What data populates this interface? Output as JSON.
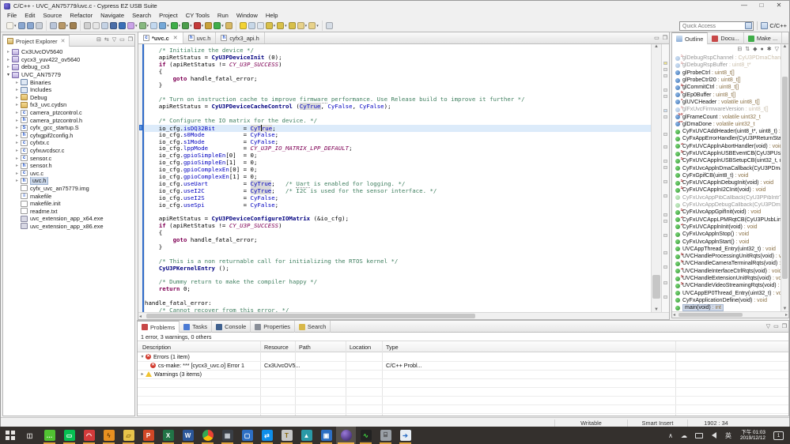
{
  "window": {
    "title": "C/C++ - UVC_AN75779/uvc.c - Cypress EZ USB Suite",
    "controls": {
      "minimize": "—",
      "maximize": "□",
      "close": "✕"
    }
  },
  "menu": [
    "File",
    "Edit",
    "Source",
    "Refactor",
    "Navigate",
    "Search",
    "Project",
    "CY Tools",
    "Run",
    "Window",
    "Help"
  ],
  "toolbar": {
    "quick_access_placeholder": "Quick Access",
    "perspective_label": "C/C++",
    "groups": [
      [
        "new-wizard",
        "save",
        "save-all",
        "print"
      ],
      [
        "skip-breakpoints",
        "build",
        "build-all"
      ],
      [
        "cut",
        "mark-occurrences",
        "step-filters",
        "terminal",
        "sync",
        "new-project",
        "new-class",
        "new-file",
        "search-c",
        "run",
        "debug",
        "profile",
        "coverage",
        "external-tools",
        "open-element"
      ],
      [
        "highlight",
        "block-select",
        "show-whitespace",
        "next-annotation",
        "prev-annotation",
        "last-edit",
        "back",
        "forward"
      ],
      [
        "pin-editor"
      ]
    ]
  },
  "project_explorer": {
    "title": "Project Explorer",
    "items": [
      {
        "l": "Cx3UvcOV5640",
        "d": 0,
        "i": "proj",
        "e": 1
      },
      {
        "l": "cycx3_yuv422_ov5640",
        "d": 0,
        "i": "proj",
        "e": 1
      },
      {
        "l": "debug_cx3",
        "d": 0,
        "i": "proj",
        "e": 1
      },
      {
        "l": "UVC_AN75779",
        "d": 0,
        "i": "proj",
        "e": 2
      },
      {
        "l": "Binaries",
        "d": 1,
        "i": "bin",
        "e": 1
      },
      {
        "l": "Includes",
        "d": 1,
        "i": "inc",
        "e": 1
      },
      {
        "l": "Debug",
        "d": 1,
        "i": "folder",
        "e": 1
      },
      {
        "l": "fx3_uvc.cydsn",
        "d": 1,
        "i": "folder",
        "e": 1
      },
      {
        "l": "camera_ptzcontrol.c",
        "d": 1,
        "i": "c",
        "e": 1
      },
      {
        "l": "camera_ptzcontrol.h",
        "d": 1,
        "i": "h",
        "e": 1
      },
      {
        "l": "cyfx_gcc_startup.S",
        "d": 1,
        "i": "s",
        "e": 1
      },
      {
        "l": "cyfxgpif2config.h",
        "d": 1,
        "i": "h",
        "e": 1
      },
      {
        "l": "cyfxtx.c",
        "d": 1,
        "i": "c",
        "e": 1
      },
      {
        "l": "cyfxuvcdscr.c",
        "d": 1,
        "i": "c",
        "e": 1
      },
      {
        "l": "sensor.c",
        "d": 1,
        "i": "c",
        "e": 1
      },
      {
        "l": "sensor.h",
        "d": 1,
        "i": "h",
        "e": 1
      },
      {
        "l": "uvc.c",
        "d": 1,
        "i": "c",
        "e": 1
      },
      {
        "l": "uvc.h",
        "d": 1,
        "i": "h",
        "e": 1,
        "sel": true
      },
      {
        "l": "cyfx_uvc_an75779.img",
        "d": 1,
        "i": "file",
        "e": 0
      },
      {
        "l": "makefile",
        "d": 1,
        "i": "mk",
        "e": 0
      },
      {
        "l": "makefile.init",
        "d": 1,
        "i": "file",
        "e": 0
      },
      {
        "l": "readme.txt",
        "d": 1,
        "i": "file",
        "e": 0
      },
      {
        "l": "uvc_extension_app_x64.exe",
        "d": 1,
        "i": "exe",
        "e": 0
      },
      {
        "l": "uvc_extension_app_x86.exe",
        "d": 1,
        "i": "exe",
        "e": 0
      }
    ]
  },
  "editor": {
    "tabs": [
      {
        "label": "*uvc.c",
        "active": true
      },
      {
        "label": "uvc.h",
        "active": false
      },
      {
        "label": "cyfx3_api.h",
        "active": false
      }
    ],
    "current_line": 11,
    "lines": [
      [
        [
          "c",
          "    /* Initialize the device */"
        ]
      ],
      [
        [
          "p",
          "    apiRetStatus = "
        ],
        [
          "fn",
          "CyU3PDeviceInit"
        ],
        [
          "p",
          " (0);"
        ]
      ],
      [
        [
          "p",
          "    "
        ],
        [
          "k",
          "if"
        ],
        [
          "p",
          " (apiRetStatus != "
        ],
        [
          "m",
          "CY_U3P_SUCCESS"
        ],
        [
          "p",
          ")"
        ]
      ],
      [
        [
          "p",
          "    {"
        ]
      ],
      [
        [
          "p",
          "        "
        ],
        [
          "k",
          "goto"
        ],
        [
          "p",
          " handle_fatal_error;"
        ]
      ],
      [
        [
          "p",
          "    }"
        ]
      ],
      [],
      [
        [
          "c",
          "    /* Turn on instruction cache to improve "
        ],
        [
          "c sp",
          "firmware"
        ],
        [
          "c",
          " performance. Use Release build to improve it further */"
        ]
      ],
      [
        [
          "p",
          "    apiRetStatus = "
        ],
        [
          "fn",
          "CyU3PDeviceCacheControl"
        ],
        [
          "p",
          " ("
        ],
        [
          "occ",
          "CyTrue"
        ],
        [
          "p",
          ", "
        ],
        [
          "e",
          "CyFalse"
        ],
        [
          "p",
          ", "
        ],
        [
          "e",
          "CyFalse"
        ],
        [
          "p",
          ");"
        ]
      ],
      [],
      [
        [
          "c",
          "    /* Configure the IO matrix for the device. */"
        ]
      ],
      [
        [
          "p",
          "    io_cfg."
        ],
        [
          "e",
          "isDQ32Bit"
        ],
        [
          "p",
          "        = "
        ],
        [
          "occ",
          "CyT"
        ],
        [
          "caret",
          ""
        ],
        [
          "occ",
          "rue"
        ],
        [
          "p",
          ";"
        ]
      ],
      [
        [
          "p",
          "    io_cfg."
        ],
        [
          "e",
          "s0Mode"
        ],
        [
          "p",
          "           = "
        ],
        [
          "e",
          "CyFalse"
        ],
        [
          "p",
          ";"
        ]
      ],
      [
        [
          "p",
          "    io_cfg."
        ],
        [
          "e",
          "s1Mode"
        ],
        [
          "p",
          "           = "
        ],
        [
          "e",
          "CyFalse"
        ],
        [
          "p",
          ";"
        ]
      ],
      [
        [
          "p",
          "    io_cfg."
        ],
        [
          "e",
          "lppMode"
        ],
        [
          "p",
          "          = "
        ],
        [
          "m",
          "CY_U3P_IO_MATRIX_LPP_DEFAULT"
        ],
        [
          "p",
          ";"
        ]
      ],
      [
        [
          "p",
          "    io_cfg."
        ],
        [
          "e",
          "gpioSimpleEn"
        ],
        [
          "p",
          "[0]  = 0;"
        ]
      ],
      [
        [
          "p",
          "    io_cfg."
        ],
        [
          "e",
          "gpioSimpleEn"
        ],
        [
          "p",
          "[1]  = 0;"
        ]
      ],
      [
        [
          "p",
          "    io_cfg."
        ],
        [
          "e",
          "gpioComplexEn"
        ],
        [
          "p",
          "[0] = 0;"
        ]
      ],
      [
        [
          "p",
          "    io_cfg."
        ],
        [
          "e",
          "gpioComplexEn"
        ],
        [
          "p",
          "[1] = 0;"
        ]
      ],
      [
        [
          "p",
          "    io_cfg."
        ],
        [
          "e",
          "useUart"
        ],
        [
          "p",
          "          = "
        ],
        [
          "occ",
          "CyTrue"
        ],
        [
          "p",
          ";   "
        ],
        [
          "c",
          "/* "
        ],
        [
          "c sp",
          "Uart"
        ],
        [
          "c",
          " is enabled for logging. */"
        ]
      ],
      [
        [
          "p",
          "    io_cfg."
        ],
        [
          "e",
          "useI2C"
        ],
        [
          "p",
          "           = "
        ],
        [
          "occ",
          "CyTrue"
        ],
        [
          "p",
          ";   "
        ],
        [
          "c",
          "/* I2C is used for the sensor interface. */"
        ]
      ],
      [
        [
          "p",
          "    io_cfg."
        ],
        [
          "e",
          "useI2S"
        ],
        [
          "p",
          "           = "
        ],
        [
          "e",
          "CyFalse"
        ],
        [
          "p",
          ";"
        ]
      ],
      [
        [
          "p",
          "    io_cfg."
        ],
        [
          "e",
          "useSpi"
        ],
        [
          "p",
          "           = "
        ],
        [
          "e",
          "CyFalse"
        ],
        [
          "p",
          ";"
        ]
      ],
      [],
      [
        [
          "p",
          "    apiRetStatus = "
        ],
        [
          "fn",
          "CyU3PDeviceConfigureIOMatrix"
        ],
        [
          "p",
          " (&io_cfg);"
        ]
      ],
      [
        [
          "p",
          "    "
        ],
        [
          "k",
          "if"
        ],
        [
          "p",
          " (apiRetStatus != "
        ],
        [
          "m",
          "CY_U3P_SUCCESS"
        ],
        [
          "p",
          ")"
        ]
      ],
      [
        [
          "p",
          "    {"
        ]
      ],
      [
        [
          "p",
          "        "
        ],
        [
          "k",
          "goto"
        ],
        [
          "p",
          " handle_fatal_error;"
        ]
      ],
      [
        [
          "p",
          "    }"
        ]
      ],
      [],
      [
        [
          "c",
          "    /* This is a non returnable call for initializing the RTOS kernel */"
        ]
      ],
      [
        [
          "p",
          "    "
        ],
        [
          "fn",
          "CyU3PKernelEntry"
        ],
        [
          "p",
          " ();"
        ]
      ],
      [],
      [
        [
          "c",
          "    /* Dummy return to make the compiler happy */"
        ]
      ],
      [
        [
          "p",
          "    "
        ],
        [
          "k",
          "return"
        ],
        [
          "p",
          " 0;"
        ]
      ],
      [],
      [
        [
          "p",
          "handle_fatal_error:"
        ]
      ],
      [
        [
          "c",
          "    /* Cannot recover from this error. */"
        ]
      ]
    ]
  },
  "outline": {
    "tabs": [
      "Outline",
      "Docu...",
      "Make ..."
    ],
    "items": [
      {
        "t": "glDebugRspChannel : CyU3PDmaChannel",
        "k": "v",
        "dim": true,
        "b": "S"
      },
      {
        "t": "glDebugRspBuffer : uint8_t*",
        "k": "v",
        "dim": true,
        "b": "S"
      },
      {
        "t": "glProbeCtrl : uint8_t[]",
        "k": "v"
      },
      {
        "t": "glProbeCtrl20 : uint8_t[]",
        "k": "v"
      },
      {
        "t": "glCommitCtrl : uint8_t[]",
        "k": "v",
        "b": "S"
      },
      {
        "t": "glEp0Buffer : uint8_t[]",
        "k": "v",
        "b": "S"
      },
      {
        "t": "glUVCHeader : volatile uint8_t[]",
        "k": "v",
        "b": "V"
      },
      {
        "t": "glFxUvcFirmwareVersion : uint8_t[]",
        "k": "v",
        "dim": true,
        "b": "S"
      },
      {
        "t": "glFrameCount : volatile uint32_t",
        "k": "v",
        "b": "SV"
      },
      {
        "t": "glDmaDone : volatile uint32_t",
        "k": "v",
        "b": "SV"
      },
      {
        "t": "CyFxUVCAddHeader(uint8_t*, uint8_t) : void",
        "k": "m"
      },
      {
        "t": "CyFxAppErrorHandler(CyU3PReturnStatus_t) : void",
        "k": "m"
      },
      {
        "t": "CyFxUVCApplnAbortHandler(void) : void",
        "k": "m",
        "b": "S"
      },
      {
        "t": "CyFxUVCApplnUSBEventCB(CyU3PUsbEventType_t, uint16_t) : void",
        "k": "m",
        "b": "S"
      },
      {
        "t": "CyFxUVCApplnUSBSetupCB(uint32_t, uint32_t) : CyBool_t",
        "k": "m",
        "b": "S"
      },
      {
        "t": "CyFxUvcApplnDmaCallback(CyU3PDmaMultiChannel*) : void",
        "k": "m"
      },
      {
        "t": "CyFxGpifCB(uint8_t) : void",
        "k": "m"
      },
      {
        "t": "CyFxUVCApplnDebugInit(void) : void",
        "k": "m",
        "b": "S"
      },
      {
        "t": "CyFxUVCApplnI2CInit(void) : void",
        "k": "m",
        "b": "S"
      },
      {
        "t": "CyFxUvcAppPibCallback(CyU3PPibIntrType, uint16_t) : void",
        "k": "m",
        "dim": true
      },
      {
        "t": "CyFxUvcAppDebugCallback(CyU3PDmaChannel*) : void",
        "k": "m",
        "dim": true
      },
      {
        "t": "CyFxUvcAppGpifInit(void) : void",
        "k": "m",
        "b": "S"
      },
      {
        "t": "CyFxUVCAppLPMRqtCB(CyU3PUsbLinkPowerMode) : CyBool_t",
        "k": "m",
        "b": "S"
      },
      {
        "t": "CyFxUVCApplnInit(void) : void",
        "k": "m",
        "b": "S"
      },
      {
        "t": "CyFxUvcApplnStop() : void",
        "k": "m"
      },
      {
        "t": "CyFxUvcApplnStart() : void",
        "k": "m"
      },
      {
        "t": "UVCAppThread_Entry(uint32_t) : void",
        "k": "m"
      },
      {
        "t": "UVCHandleProcessingUnitRqts(void) : void",
        "k": "m",
        "b": "S"
      },
      {
        "t": "UVCHandleCameraTerminalRqts(void) : void",
        "k": "m",
        "b": "S"
      },
      {
        "t": "UVCHandleInterfaceCtrlRqts(void) : void",
        "k": "m",
        "b": "S"
      },
      {
        "t": "UVCHandleExtensionUnitRqts(void) : void",
        "k": "m",
        "b": "S"
      },
      {
        "t": "UVCHandleVideoStreamingRqts(void) : void",
        "k": "m",
        "b": "S"
      },
      {
        "t": "UVCAppEP0Thread_Entry(uint32_t) : void",
        "k": "m"
      },
      {
        "t": "CyFxApplicationDefine(void) : void",
        "k": "m"
      },
      {
        "t": "main(void) : int",
        "k": "m",
        "sel": true
      }
    ]
  },
  "problems": {
    "tabs": [
      "Problems",
      "Tasks",
      "Console",
      "Properties",
      "Search"
    ],
    "active_tab": "Problems",
    "summary": "1 error, 3 warnings, 0 others",
    "columns": [
      "Description",
      "Resource",
      "Path",
      "Location",
      "Type"
    ],
    "rows": [
      {
        "kind": "error-group",
        "expanded": true,
        "text": "Errors (1 item)"
      },
      {
        "kind": "error",
        "text": "cs-make: *** [cycx3_uvc.o] Error 1",
        "resource": "Cx3UvcOV5...",
        "path": "",
        "location": "",
        "type": "C/C++ Probl..."
      },
      {
        "kind": "warning-group",
        "expanded": false,
        "text": "Warnings (3 items)"
      }
    ]
  },
  "status_bar": {
    "writable": "Writable",
    "insert_mode": "Smart Insert",
    "caret_position": "1902 : 34"
  },
  "taskbar": {
    "apps": [
      "start",
      "task-view",
      "wechat",
      "line",
      "app-red",
      "flash",
      "file-explorer",
      "powerpoint",
      "excel",
      "word",
      "chrome",
      "calculator",
      "app-window",
      "teamviewer",
      "app-t",
      "photos",
      "app-window-2",
      "eclipse",
      "network-monitor",
      "app-gray",
      "file-transfer"
    ],
    "active_app": "eclipse",
    "tray": {
      "ime": "英",
      "time": "下午 01:03",
      "date": "2019/12/12",
      "notification_count": "1"
    }
  },
  "colors": {
    "selection": "#c9d6e8",
    "current_line": "#dcebfa",
    "comment": "#3F7F5F",
    "keyword": "#7F0055",
    "field": "#0000C0",
    "function_ref": "#000080",
    "occurrence_bg": "#d9d9d9",
    "taskbar_underline": "#e0a23c"
  }
}
